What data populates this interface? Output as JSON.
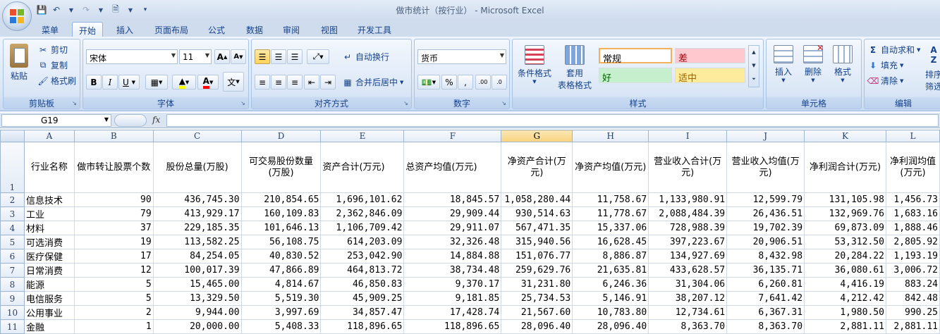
{
  "window": {
    "title": "做市统计（按行业） - Microsoft Excel"
  },
  "tabs": [
    {
      "label": "菜单",
      "active": false
    },
    {
      "label": "开始",
      "active": true
    },
    {
      "label": "插入",
      "active": false
    },
    {
      "label": "页面布局",
      "active": false
    },
    {
      "label": "公式",
      "active": false
    },
    {
      "label": "数据",
      "active": false
    },
    {
      "label": "审阅",
      "active": false
    },
    {
      "label": "视图",
      "active": false
    },
    {
      "label": "开发工具",
      "active": false
    }
  ],
  "ribbon": {
    "clipboard": {
      "label": "剪贴板",
      "paste": "粘贴",
      "cut": "剪切",
      "copy": "复制",
      "format_painter": "格式刷"
    },
    "font": {
      "label": "字体",
      "font_name": "宋体",
      "font_size": "11"
    },
    "alignment": {
      "label": "对齐方式",
      "wrap_text": "自动换行",
      "merge_center": "合并后居中"
    },
    "number": {
      "label": "数字",
      "format": "货币"
    },
    "styles": {
      "label": "样式",
      "conditional_format": "条件格式",
      "table_format_1": "套用",
      "table_format_2": "表格格式",
      "normal": "常规",
      "bad": "差",
      "good": "好",
      "neutral": "适中"
    },
    "cells": {
      "label": "单元格",
      "insert": "插入",
      "delete": "删除",
      "format": "格式"
    },
    "editing": {
      "label": "编辑",
      "autosum": "自动求和",
      "fill": "填充",
      "clear": "清除",
      "sort": "排序",
      "filter": "筛选"
    }
  },
  "formula_bar": {
    "name_box": "G19",
    "fx": "fx",
    "formula": ""
  },
  "colors": {
    "selected_header": "#f8d37f",
    "ribbon_bg": "#dbe7f6",
    "grid_line": "#d0d7e5",
    "bad_fill": "#ffc7ce",
    "good_fill": "#c6efce",
    "neutral_fill": "#ffeb9c"
  },
  "sheet": {
    "columns": [
      "A",
      "B",
      "C",
      "D",
      "E",
      "F",
      "G",
      "H",
      "I",
      "J",
      "K",
      "L"
    ],
    "selected_column": "G",
    "header_row": [
      "行业名称",
      "做市转让股票个数",
      "股份总量(万股)",
      "可交易股份数量(万股)",
      "资产合计(万元)",
      "总资产均值(万元)",
      "净资产合计(万元)",
      "净资产均值(万元)",
      "营业收入合计(万元)",
      "营业收入均值(万元)",
      "净利润合计(万元)",
      "净利润均值(万元)"
    ],
    "rows": [
      {
        "n": "2",
        "cells": [
          "信息技术",
          "90",
          "436,745.30",
          "210,854.65",
          "1,696,101.62",
          "18,845.57",
          "1,058,280.44",
          "11,758.67",
          "1,133,980.91",
          "12,599.79",
          "131,105.98",
          "1,456.73"
        ]
      },
      {
        "n": "3",
        "cells": [
          "工业",
          "79",
          "413,929.17",
          "160,109.83",
          "2,362,846.09",
          "29,909.44",
          "930,514.63",
          "11,778.67",
          "2,088,484.39",
          "26,436.51",
          "132,969.76",
          "1,683.16"
        ]
      },
      {
        "n": "4",
        "cells": [
          "材料",
          "37",
          "229,185.35",
          "101,646.13",
          "1,106,709.42",
          "29,911.07",
          "567,471.35",
          "15,337.06",
          "728,988.39",
          "19,702.39",
          "69,873.09",
          "1,888.46"
        ]
      },
      {
        "n": "5",
        "cells": [
          "可选消费",
          "19",
          "113,582.25",
          "56,108.75",
          "614,203.09",
          "32,326.48",
          "315,940.56",
          "16,628.45",
          "397,223.67",
          "20,906.51",
          "53,312.50",
          "2,805.92"
        ]
      },
      {
        "n": "6",
        "cells": [
          "医疗保健",
          "17",
          "84,254.05",
          "40,830.52",
          "253,042.90",
          "14,884.88",
          "151,076.77",
          "8,886.87",
          "134,927.69",
          "8,432.98",
          "20,284.22",
          "1,193.19"
        ]
      },
      {
        "n": "7",
        "cells": [
          "日常消费",
          "12",
          "100,017.39",
          "47,866.89",
          "464,813.72",
          "38,734.48",
          "259,629.76",
          "21,635.81",
          "433,628.57",
          "36,135.71",
          "36,080.61",
          "3,006.72"
        ]
      },
      {
        "n": "8",
        "cells": [
          "能源",
          "5",
          "15,465.00",
          "4,814.67",
          "46,850.83",
          "9,370.17",
          "31,231.80",
          "6,246.36",
          "31,304.06",
          "6,260.81",
          "4,416.19",
          "883.24"
        ]
      },
      {
        "n": "9",
        "cells": [
          "电信服务",
          "5",
          "13,329.50",
          "5,519.30",
          "45,909.25",
          "9,181.85",
          "25,734.53",
          "5,146.91",
          "38,207.12",
          "7,641.42",
          "4,212.42",
          "842.48"
        ]
      },
      {
        "n": "10",
        "cells": [
          "公用事业",
          "2",
          "9,944.00",
          "3,997.69",
          "34,857.47",
          "17,428.74",
          "21,567.60",
          "10,783.80",
          "12,734.61",
          "6,367.31",
          "1,980.50",
          "990.25"
        ]
      },
      {
        "n": "11",
        "cells": [
          "金融",
          "1",
          "20,000.00",
          "5,408.33",
          "118,896.65",
          "118,896.65",
          "28,096.40",
          "28,096.40",
          "8,363.70",
          "8,363.70",
          "2,881.11",
          "2,881.11"
        ]
      }
    ]
  }
}
